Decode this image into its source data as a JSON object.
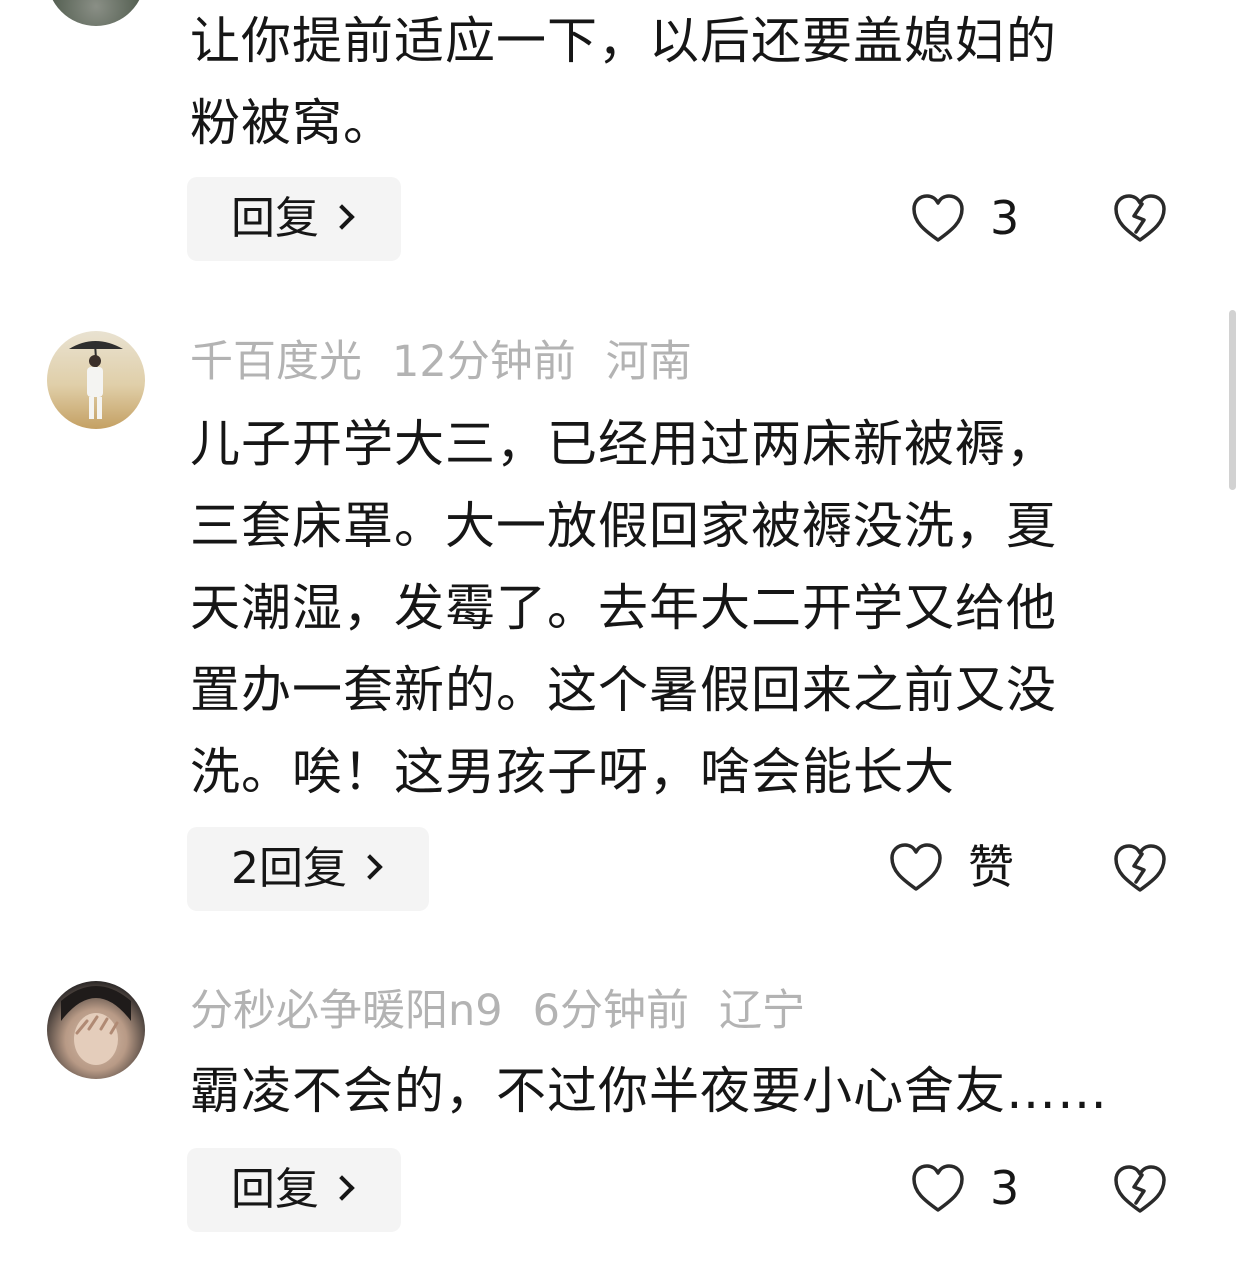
{
  "comments": [
    {
      "author": "",
      "time": "",
      "location": "",
      "text_lines": [
        "让你提前适应一下，以后还要盖媳妇的",
        "粉被窝。"
      ],
      "reply_label": "回复",
      "likes": "3",
      "avatar_colors": [
        "#3c4a3a",
        "#8a8f86"
      ]
    },
    {
      "author": "千百度光",
      "time": "12分钟前",
      "location": "河南",
      "text_lines": [
        "儿子开学大三，已经用过两床新被褥，",
        "三套床罩。大一放假回家被褥没洗，夏",
        "天潮湿，发霉了。去年大二开学又给他",
        "置办一套新的。这个暑假回来之前又没",
        "洗。唉！这男孩子呀，啥会能长大"
      ],
      "reply_label": "2回复",
      "likes": "赞",
      "avatar_colors": [
        "#c9a86a",
        "#eae3d2"
      ]
    },
    {
      "author": "分秒必争暖阳n9",
      "time": "6分钟前",
      "location": "辽宁",
      "text_lines": [
        "霸凌不会的，不过你半夜要小心舍友……"
      ],
      "reply_label": "回复",
      "likes": "3",
      "avatar_colors": [
        "#2f2b2a",
        "#d8c0ad"
      ]
    }
  ]
}
